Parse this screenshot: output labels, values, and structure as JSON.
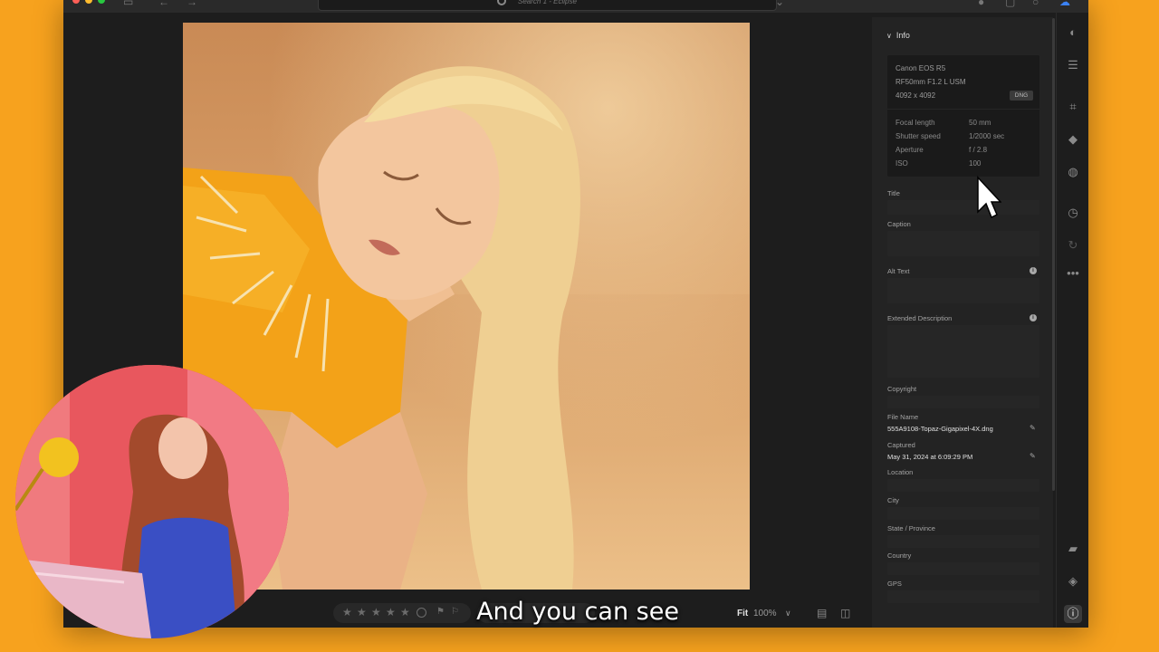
{
  "search": {
    "placeholder": "Search 1 - Eclipse"
  },
  "info_panel": {
    "header": "Info",
    "camera": "Canon EOS R5",
    "lens": "RF50mm F1.2 L USM",
    "dimensions": "4092 x 4092",
    "format_badge": "DNG",
    "exif": [
      {
        "label": "Focal length",
        "value": "50 mm"
      },
      {
        "label": "Shutter speed",
        "value": "1/2000 sec"
      },
      {
        "label": "Aperture",
        "value": "f / 2.8"
      },
      {
        "label": "ISO",
        "value": "100"
      }
    ],
    "fields": {
      "title": "Title",
      "caption": "Caption",
      "alt_text": "Alt Text",
      "extended_description": "Extended Description",
      "copyright": "Copyright",
      "file_name_label": "File Name",
      "file_name_value": "555A9108-Topaz-Gigapixel-4X.dng",
      "captured_label": "Captured",
      "captured_value": "May 31, 2024 at 6:09:29 PM",
      "location": "Location",
      "city": "City",
      "state": "State / Province",
      "country": "Country",
      "gps": "GPS"
    }
  },
  "bottom_bar": {
    "fit": "Fit",
    "zoom": "100%"
  },
  "rating": {
    "stars": 0,
    "max": 5
  },
  "subtitle": "And you can see",
  "icons": {
    "rail": [
      "edit-icon",
      "sliders-icon",
      "crop-icon",
      "eraser-icon",
      "masking-icon",
      "history-icon",
      "sync-icon",
      "more-icon",
      "comment-icon",
      "tag-icon",
      "info-icon"
    ]
  }
}
